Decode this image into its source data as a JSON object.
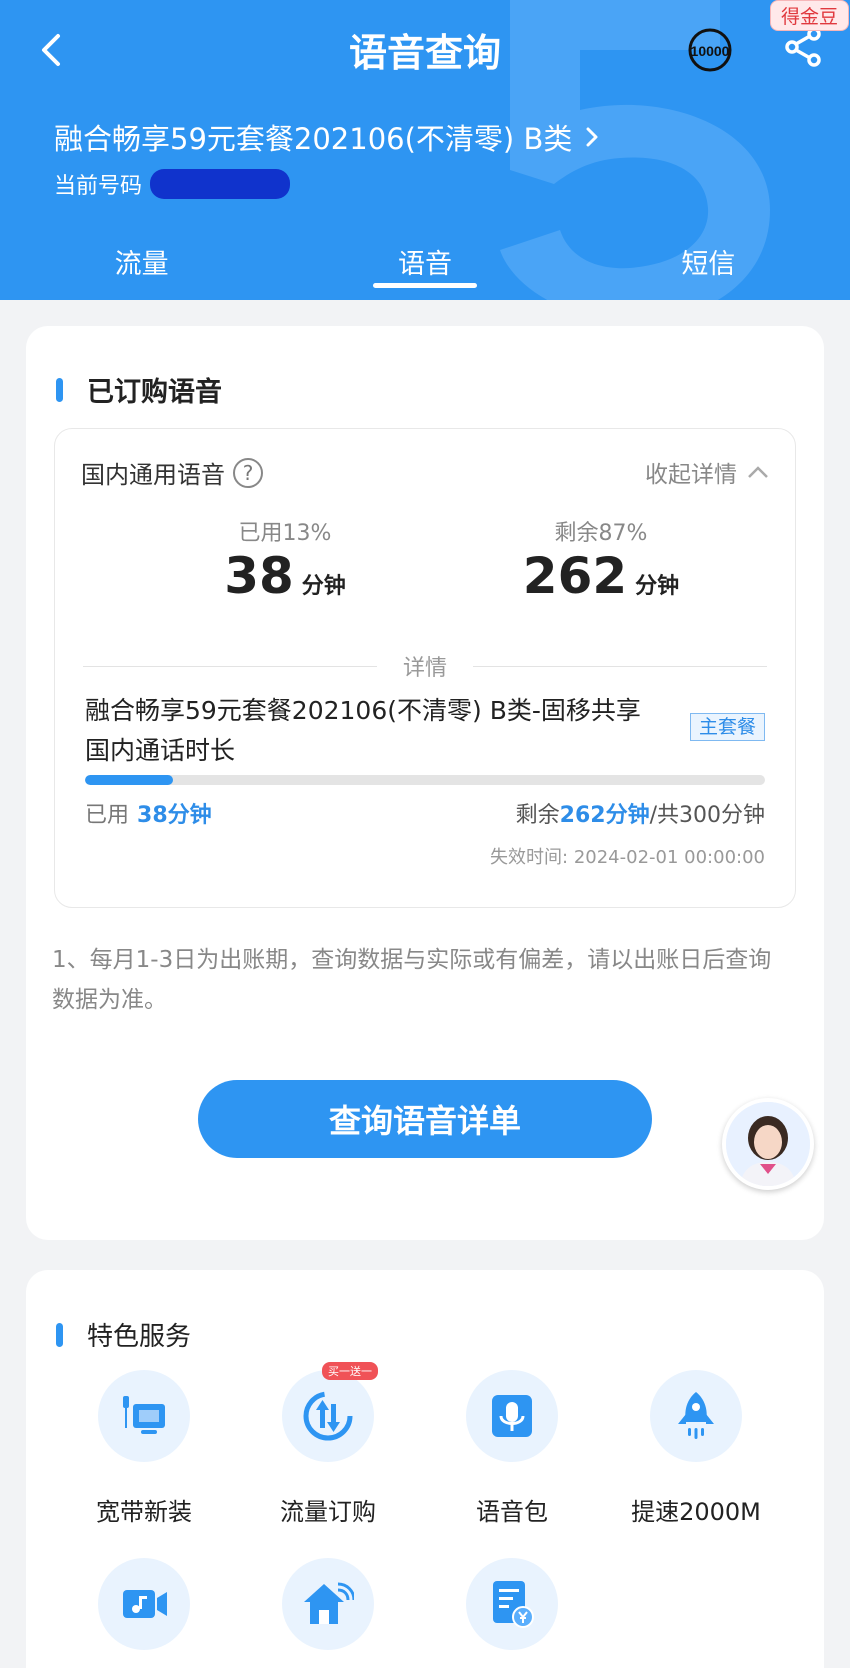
{
  "header": {
    "title": "语音查询",
    "badge": "得金豆",
    "service_number": "10000",
    "plan_name": "融合畅享59元套餐202106(不清零) B类",
    "phone_label": "当前号码"
  },
  "tabs": [
    {
      "label": "流量",
      "active": false
    },
    {
      "label": "语音",
      "active": true
    },
    {
      "label": "短信",
      "active": false
    }
  ],
  "purchased": {
    "section_title": "已订购语音",
    "category": "国内通用语音",
    "collapse_label": "收起详情",
    "used_label": "已用13%",
    "used_value": "38",
    "remain_label": "剩余87%",
    "remain_value": "262",
    "unit": "分钟",
    "detail_divider": "详情",
    "package_name": "融合畅享59元套餐202106(不清零) B类-固移共享国内通话时长",
    "tag": "主套餐",
    "progress": 0.13,
    "used_prefix": "已用",
    "used_text": "38分钟",
    "remain_prefix": "剩余",
    "remain_text": "262分钟",
    "total_text": "/共300分钟",
    "expire_label": "失效时间:",
    "expire_time": "2024-02-01 00:00:00"
  },
  "note": "1、每月1-3日为出账期，查询数据与实际或有偏差，请以出账日后查询数据为准。",
  "query_button": "查询语音详单",
  "services": {
    "section_title": "特色服务",
    "items": [
      {
        "label": "宽带新装",
        "icon": "broadband-monitor-icon"
      },
      {
        "label": "流量订购",
        "icon": "data-traffic-icon",
        "promo": "买一送一"
      },
      {
        "label": "语音包",
        "icon": "microphone-icon"
      },
      {
        "label": "提速2000M",
        "icon": "rocket-icon"
      },
      {
        "label": "",
        "icon": "video-music-icon"
      },
      {
        "label": "",
        "icon": "smart-home-icon"
      },
      {
        "label": "",
        "icon": "annual-bill-icon"
      }
    ]
  },
  "colors": {
    "primary": "#2e95f2",
    "accent_red": "#f05257"
  }
}
